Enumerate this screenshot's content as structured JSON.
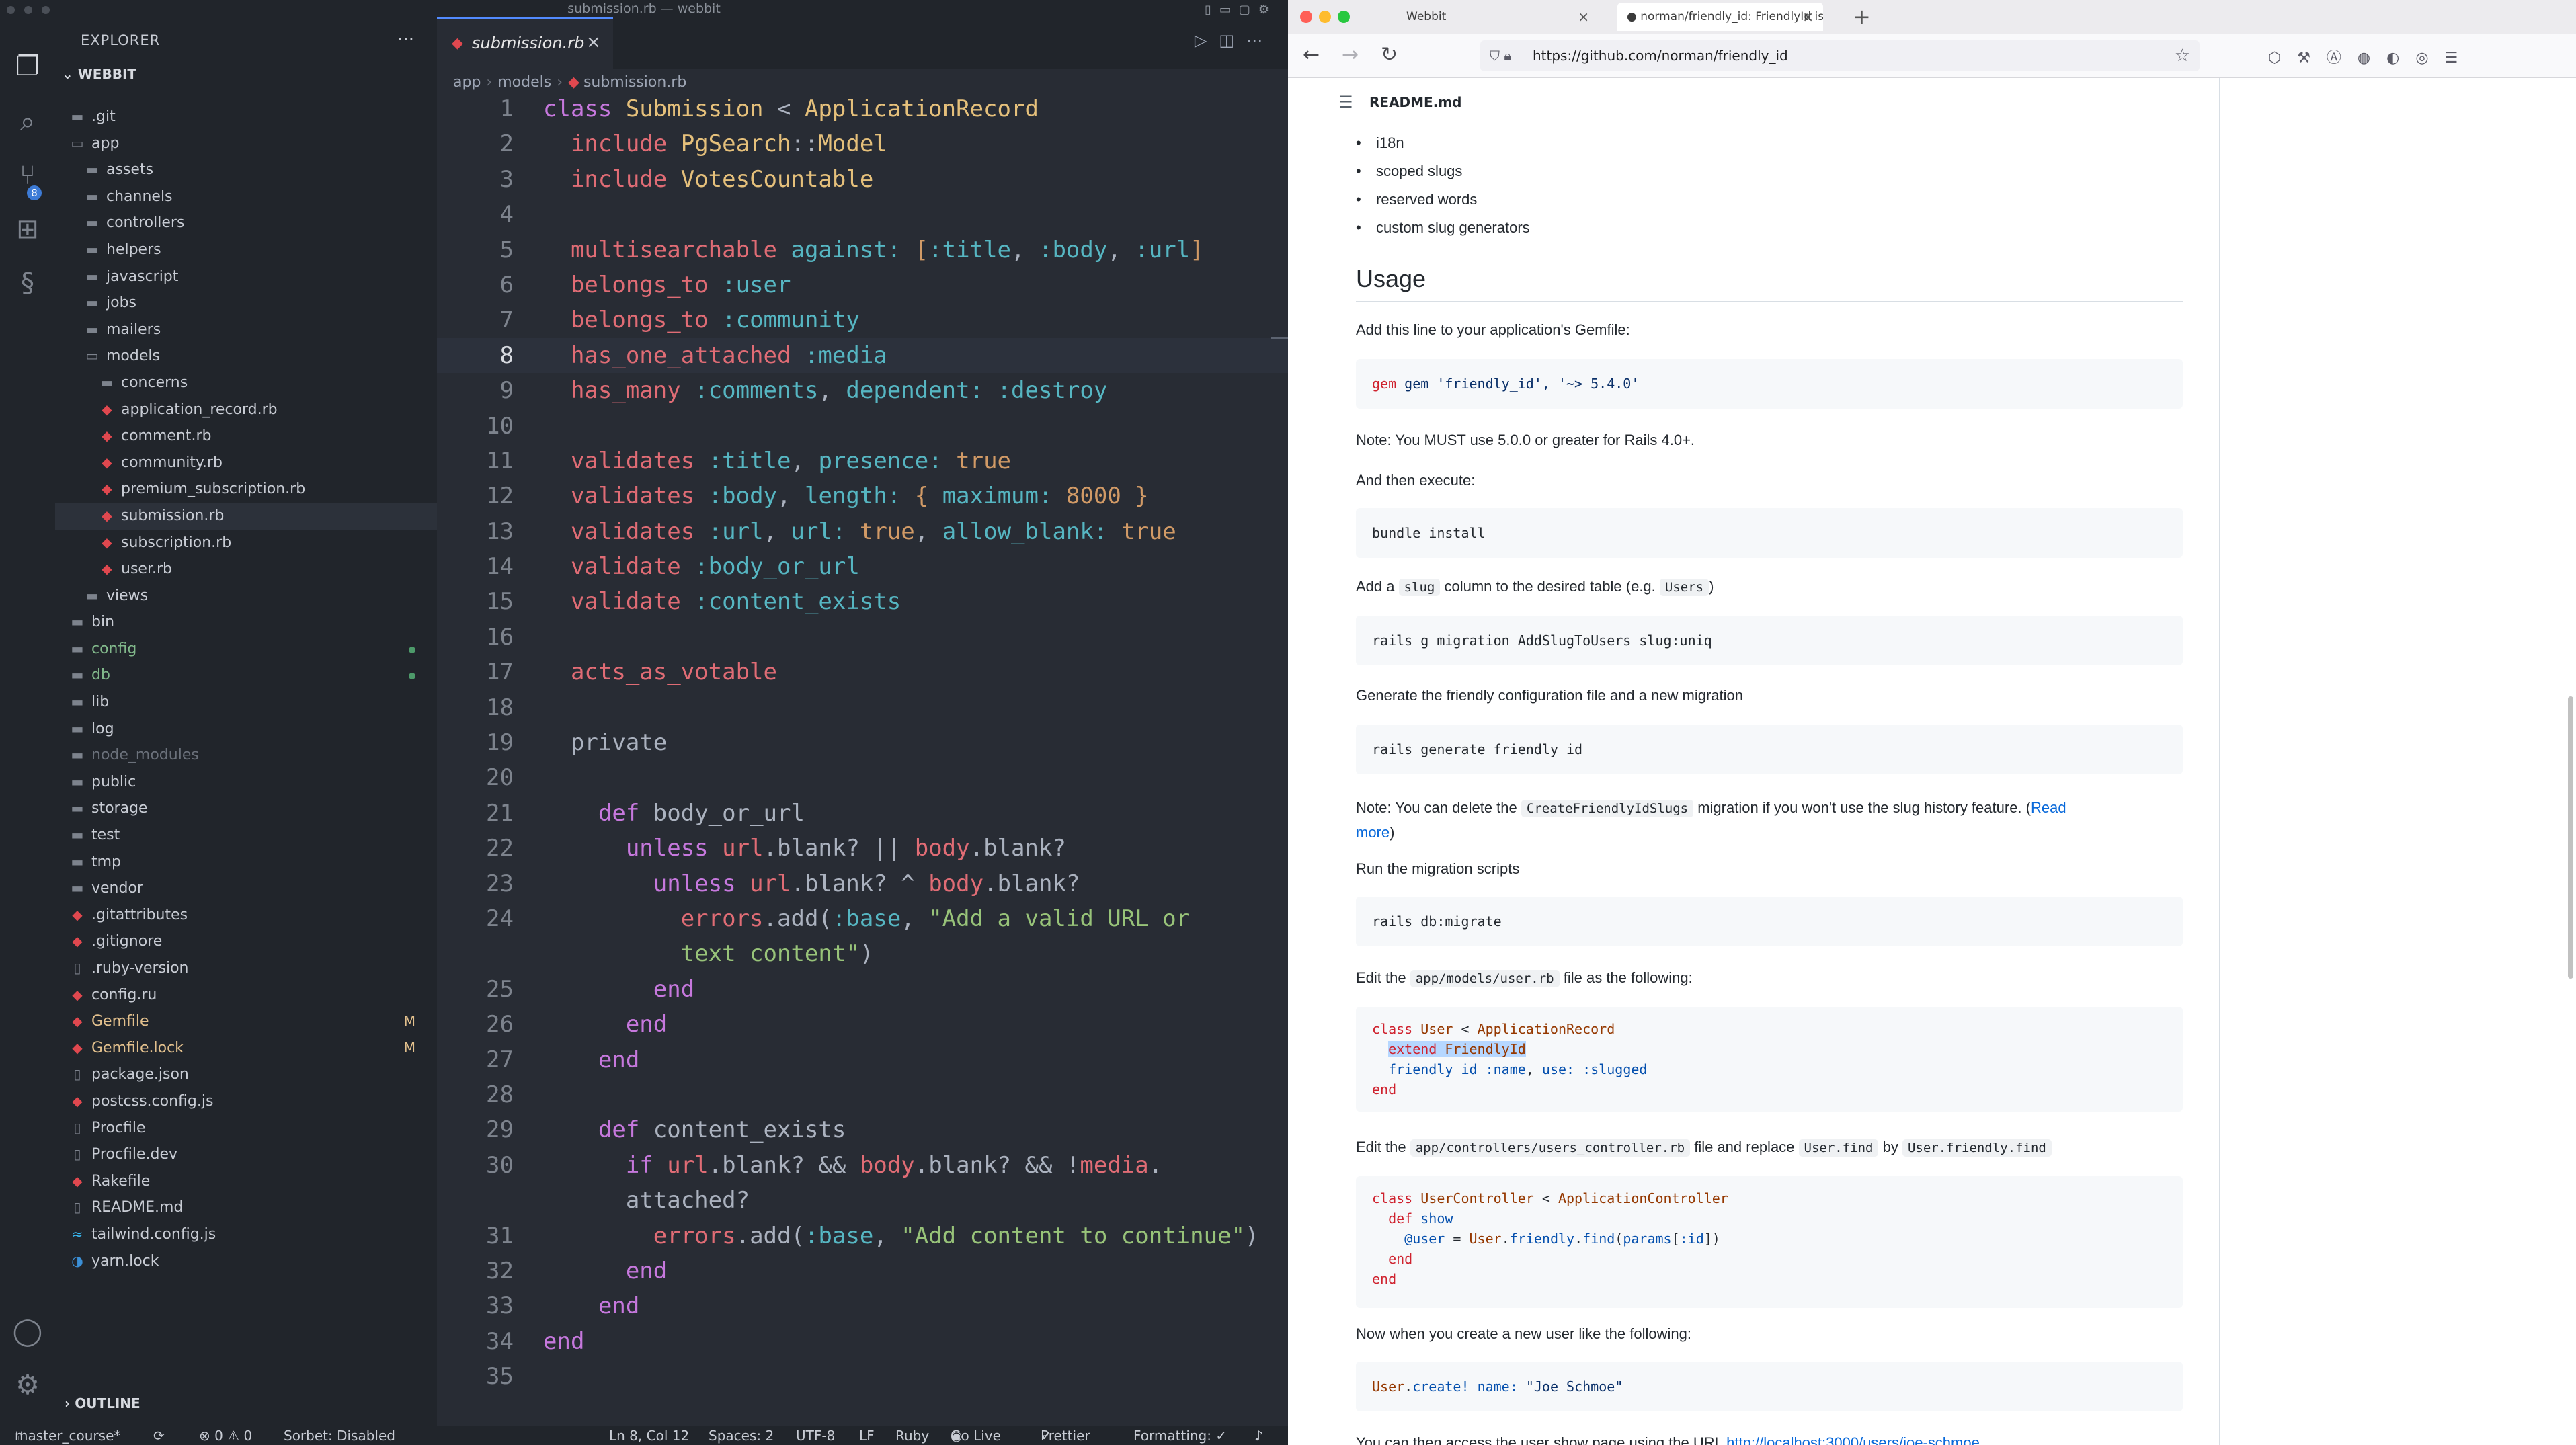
{
  "editor": {
    "window_title": "submission.rb — webbit",
    "activity_badge": "8",
    "explorer": {
      "header": "EXPLORER",
      "more": "···",
      "root": "WEBBIT",
      "tree": [
        {
          "label": ".git",
          "depth": 0,
          "kind": "folder",
          "chev": "›"
        },
        {
          "label": "app",
          "depth": 0,
          "kind": "folder-open",
          "chev": "⌄"
        },
        {
          "label": "assets",
          "depth": 1,
          "kind": "folder",
          "chev": "›"
        },
        {
          "label": "channels",
          "depth": 1,
          "kind": "folder",
          "chev": "›"
        },
        {
          "label": "controllers",
          "depth": 1,
          "kind": "folder",
          "chev": "›"
        },
        {
          "label": "helpers",
          "depth": 1,
          "kind": "folder",
          "chev": "›"
        },
        {
          "label": "javascript",
          "depth": 1,
          "kind": "folder",
          "chev": "›"
        },
        {
          "label": "jobs",
          "depth": 1,
          "kind": "folder",
          "chev": "›"
        },
        {
          "label": "mailers",
          "depth": 1,
          "kind": "folder",
          "chev": "›"
        },
        {
          "label": "models",
          "depth": 1,
          "kind": "folder-open",
          "chev": "⌄"
        },
        {
          "label": "concerns",
          "depth": 2,
          "kind": "folder",
          "chev": "›"
        },
        {
          "label": "application_record.rb",
          "depth": 2,
          "kind": "ruby"
        },
        {
          "label": "comment.rb",
          "depth": 2,
          "kind": "ruby"
        },
        {
          "label": "community.rb",
          "depth": 2,
          "kind": "ruby"
        },
        {
          "label": "premium_subscription.rb",
          "depth": 2,
          "kind": "ruby"
        },
        {
          "label": "submission.rb",
          "depth": 2,
          "kind": "ruby",
          "selected": true
        },
        {
          "label": "subscription.rb",
          "depth": 2,
          "kind": "ruby"
        },
        {
          "label": "user.rb",
          "depth": 2,
          "kind": "ruby"
        },
        {
          "label": "views",
          "depth": 1,
          "kind": "folder",
          "chev": "›"
        },
        {
          "label": "bin",
          "depth": 0,
          "kind": "folder",
          "chev": "›"
        },
        {
          "label": "config",
          "depth": 0,
          "kind": "folder",
          "chev": "›",
          "git": true,
          "dot": true
        },
        {
          "label": "db",
          "depth": 0,
          "kind": "folder",
          "chev": "›",
          "git": true,
          "dot": true
        },
        {
          "label": "lib",
          "depth": 0,
          "kind": "folder",
          "chev": "›"
        },
        {
          "label": "log",
          "depth": 0,
          "kind": "folder",
          "chev": "›"
        },
        {
          "label": "node_modules",
          "depth": 0,
          "kind": "folder",
          "chev": "›",
          "dim": true
        },
        {
          "label": "public",
          "depth": 0,
          "kind": "folder",
          "chev": "›"
        },
        {
          "label": "storage",
          "depth": 0,
          "kind": "folder",
          "chev": "›"
        },
        {
          "label": "test",
          "depth": 0,
          "kind": "folder",
          "chev": "›"
        },
        {
          "label": "tmp",
          "depth": 0,
          "kind": "folder",
          "chev": "›"
        },
        {
          "label": "vendor",
          "depth": 0,
          "kind": "folder",
          "chev": "›"
        },
        {
          "label": ".gitattributes",
          "depth": 0,
          "kind": "gitfile"
        },
        {
          "label": ".gitignore",
          "depth": 0,
          "kind": "gitfile"
        },
        {
          "label": ".ruby-version",
          "depth": 0,
          "kind": "file"
        },
        {
          "label": "config.ru",
          "depth": 0,
          "kind": "ruby"
        },
        {
          "label": "Gemfile",
          "depth": 0,
          "kind": "ruby",
          "badge": "M",
          "mod": true
        },
        {
          "label": "Gemfile.lock",
          "depth": 0,
          "kind": "ruby",
          "badge": "M",
          "mod": true
        },
        {
          "label": "package.json",
          "depth": 0,
          "kind": "file"
        },
        {
          "label": "postcss.config.js",
          "depth": 0,
          "kind": "ruby"
        },
        {
          "label": "Procfile",
          "depth": 0,
          "kind": "file"
        },
        {
          "label": "Procfile.dev",
          "depth": 0,
          "kind": "file"
        },
        {
          "label": "Rakefile",
          "depth": 0,
          "kind": "ruby"
        },
        {
          "label": "README.md",
          "depth": 0,
          "kind": "file"
        },
        {
          "label": "tailwind.config.js",
          "depth": 0,
          "kind": "tw"
        },
        {
          "label": "yarn.lock",
          "depth": 0,
          "kind": "yarn"
        }
      ],
      "outline_label": "OUTLINE"
    },
    "tab": {
      "label": "submission.rb",
      "close": "×"
    },
    "breadcrumb": [
      "app",
      "models",
      "submission.rb"
    ],
    "current_line": 8,
    "code_lines": [
      {
        "n": "1",
        "t": [
          [
            "kw",
            "class "
          ],
          [
            "cls",
            "Submission"
          ],
          [
            "pl",
            " < "
          ],
          [
            "cls",
            "ApplicationRecord"
          ]
        ]
      },
      {
        "n": "2",
        "t": [
          [
            "pl",
            "  "
          ],
          [
            "fn",
            "include "
          ],
          [
            "cls",
            "PgSearch"
          ],
          [
            "pl",
            "::"
          ],
          [
            "cls",
            "Model"
          ]
        ]
      },
      {
        "n": "3",
        "t": [
          [
            "pl",
            "  "
          ],
          [
            "fn",
            "include "
          ],
          [
            "cls",
            "VotesCountable"
          ]
        ]
      },
      {
        "n": "4",
        "t": []
      },
      {
        "n": "5",
        "t": [
          [
            "pl",
            "  "
          ],
          [
            "fn",
            "multisearchable "
          ],
          [
            "sym",
            "against: "
          ],
          [
            "br",
            "["
          ],
          [
            "sym",
            ":title"
          ],
          [
            "pl",
            ", "
          ],
          [
            "sym",
            ":body"
          ],
          [
            "pl",
            ", "
          ],
          [
            "sym",
            ":url"
          ],
          [
            "br",
            "]"
          ]
        ]
      },
      {
        "n": "6",
        "t": [
          [
            "pl",
            "  "
          ],
          [
            "fn",
            "belongs_to "
          ],
          [
            "sym",
            ":user"
          ]
        ]
      },
      {
        "n": "7",
        "t": [
          [
            "pl",
            "  "
          ],
          [
            "fn",
            "belongs_to "
          ],
          [
            "sym",
            ":community"
          ]
        ]
      },
      {
        "n": "8",
        "t": [
          [
            "pl",
            "  "
          ],
          [
            "fn",
            "has_one_attached "
          ],
          [
            "sym",
            ":media"
          ]
        ]
      },
      {
        "n": "9",
        "t": [
          [
            "pl",
            "  "
          ],
          [
            "fn",
            "has_many "
          ],
          [
            "sym",
            ":comments"
          ],
          [
            "pl",
            ", "
          ],
          [
            "sym",
            "dependent: :destroy"
          ]
        ]
      },
      {
        "n": "10",
        "t": []
      },
      {
        "n": "11",
        "t": [
          [
            "pl",
            "  "
          ],
          [
            "fn",
            "validates "
          ],
          [
            "sym",
            ":title"
          ],
          [
            "pl",
            ", "
          ],
          [
            "sym",
            "presence: "
          ],
          [
            "br",
            "true"
          ]
        ]
      },
      {
        "n": "12",
        "t": [
          [
            "pl",
            "  "
          ],
          [
            "fn",
            "validates "
          ],
          [
            "sym",
            ":body"
          ],
          [
            "pl",
            ", "
          ],
          [
            "sym",
            "length: "
          ],
          [
            "br",
            "{ "
          ],
          [
            "sym",
            "maximum: "
          ],
          [
            "br",
            "8000 }"
          ]
        ]
      },
      {
        "n": "13",
        "t": [
          [
            "pl",
            "  "
          ],
          [
            "fn",
            "validates "
          ],
          [
            "sym",
            ":url"
          ],
          [
            "pl",
            ", "
          ],
          [
            "sym",
            "url: "
          ],
          [
            "br",
            "true"
          ],
          [
            "pl",
            ", "
          ],
          [
            "sym",
            "allow_blank: "
          ],
          [
            "br",
            "true"
          ]
        ]
      },
      {
        "n": "14",
        "t": [
          [
            "pl",
            "  "
          ],
          [
            "fn",
            "validate "
          ],
          [
            "sym",
            ":body_or_url"
          ]
        ]
      },
      {
        "n": "15",
        "t": [
          [
            "pl",
            "  "
          ],
          [
            "fn",
            "validate "
          ],
          [
            "sym",
            ":content_exists"
          ]
        ]
      },
      {
        "n": "16",
        "t": []
      },
      {
        "n": "17",
        "t": [
          [
            "pl",
            "  "
          ],
          [
            "fn",
            "acts_as_votable"
          ]
        ]
      },
      {
        "n": "18",
        "t": []
      },
      {
        "n": "19",
        "t": [
          [
            "pl",
            "  "
          ],
          [
            "pl",
            "private"
          ]
        ]
      },
      {
        "n": "20",
        "t": []
      },
      {
        "n": "21",
        "t": [
          [
            "pl",
            "    "
          ],
          [
            "kw",
            "def "
          ],
          [
            "pl",
            "body_or_url"
          ]
        ]
      },
      {
        "n": "22",
        "t": [
          [
            "pl",
            "      "
          ],
          [
            "kw",
            "unless "
          ],
          [
            "fn",
            "url"
          ],
          [
            "pl",
            ".blank? || "
          ],
          [
            "fn",
            "body"
          ],
          [
            "pl",
            ".blank?"
          ]
        ]
      },
      {
        "n": "23",
        "t": [
          [
            "pl",
            "        "
          ],
          [
            "kw",
            "unless "
          ],
          [
            "fn",
            "url"
          ],
          [
            "pl",
            ".blank? ^ "
          ],
          [
            "fn",
            "body"
          ],
          [
            "pl",
            ".blank?"
          ]
        ]
      },
      {
        "n": "24",
        "t": [
          [
            "pl",
            "          "
          ],
          [
            "fn",
            "errors"
          ],
          [
            "pl",
            ".add("
          ],
          [
            "sym",
            ":base"
          ],
          [
            "pl",
            ", "
          ],
          [
            "str",
            "\"Add a valid URL or"
          ]
        ]
      },
      {
        "n": "",
        "t": [
          [
            "pl",
            "          "
          ],
          [
            "str",
            "text content\""
          ],
          [
            "pl",
            ")"
          ]
        ]
      },
      {
        "n": "25",
        "t": [
          [
            "pl",
            "        "
          ],
          [
            "kw",
            "end"
          ]
        ]
      },
      {
        "n": "26",
        "t": [
          [
            "pl",
            "      "
          ],
          [
            "kw",
            "end"
          ]
        ]
      },
      {
        "n": "27",
        "t": [
          [
            "pl",
            "    "
          ],
          [
            "kw",
            "end"
          ]
        ]
      },
      {
        "n": "28",
        "t": []
      },
      {
        "n": "29",
        "t": [
          [
            "pl",
            "    "
          ],
          [
            "kw",
            "def "
          ],
          [
            "pl",
            "content_exists"
          ]
        ]
      },
      {
        "n": "30",
        "t": [
          [
            "pl",
            "      "
          ],
          [
            "kw",
            "if "
          ],
          [
            "fn",
            "url"
          ],
          [
            "pl",
            ".blank? && "
          ],
          [
            "fn",
            "body"
          ],
          [
            "pl",
            ".blank? && !"
          ],
          [
            "fn",
            "media"
          ],
          [
            "pl",
            "."
          ]
        ]
      },
      {
        "n": "",
        "t": [
          [
            "pl",
            "      attached?"
          ]
        ]
      },
      {
        "n": "31",
        "t": [
          [
            "pl",
            "        "
          ],
          [
            "fn",
            "errors"
          ],
          [
            "pl",
            ".add("
          ],
          [
            "sym",
            ":base"
          ],
          [
            "pl",
            ", "
          ],
          [
            "str",
            "\"Add content to continue\""
          ],
          [
            "pl",
            ")"
          ]
        ]
      },
      {
        "n": "32",
        "t": [
          [
            "pl",
            "      "
          ],
          [
            "kw",
            "end"
          ]
        ]
      },
      {
        "n": "33",
        "t": [
          [
            "pl",
            "    "
          ],
          [
            "kw",
            "end"
          ]
        ]
      },
      {
        "n": "34",
        "t": [
          [
            "kw",
            "end"
          ]
        ]
      },
      {
        "n": "35",
        "t": []
      }
    ],
    "status": {
      "branch": "master_course*",
      "problems": "⊗ 0 ⚠ 0",
      "sorbet": "Sorbet: Disabled",
      "position": "Ln 8, Col 12",
      "spaces": "Spaces: 2",
      "encoding": "UTF-8",
      "eol": "LF",
      "language": "Ruby",
      "golive": "Go Live",
      "prettier": "Prettier",
      "formatting": "Formatting: ✓"
    }
  },
  "browser": {
    "tabs": [
      {
        "label": "Webbit",
        "active": false
      },
      {
        "label": "norman/friendly_id: FriendlyId is",
        "active": true
      }
    ],
    "url": "https://github.com/norman/friendly_id",
    "readme_file": "README.md",
    "bullets": [
      "i18n",
      "scoped slugs",
      "reserved words",
      "custom slug generators"
    ],
    "h2_usage": "Usage",
    "p_add_line": "Add this line to your application's Gemfile:",
    "code_gemfile": "gem 'friendly_id', '~> 5.4.0'",
    "p_note_version": "Note: You MUST use 5.0.0 or greater for Rails 4.0+.",
    "p_execute": "And then execute:",
    "code_bundle": "bundle install",
    "p_add_slug_a": "Add a ",
    "p_add_slug_code": "slug",
    "p_add_slug_b": " column to the desired table (e.g. ",
    "p_add_slug_code2": "Users",
    "p_add_slug_c": ")",
    "code_migration": "rails g migration AddSlugToUsers slug:uniq",
    "p_generate": "Generate the friendly configuration file and a new migration",
    "code_generate": "rails generate friendly_id",
    "p_note_delete_a": "Note: You can delete the ",
    "p_note_delete_code": "CreateFriendlyIdSlugs",
    "p_note_delete_b": " migration if you won't use the slug history feature. (",
    "p_note_delete_link": "Read",
    "p_note_delete_link2": "more",
    "p_note_delete_c": ")",
    "p_run": "Run the migration scripts",
    "code_migrate": "rails db:migrate",
    "p_edit_user_a": "Edit the ",
    "p_edit_user_code": "app/models/user.rb",
    "p_edit_user_b": " file as the following:",
    "p_edit_ctrl_a": "Edit the ",
    "p_edit_ctrl_code": "app/controllers/users_controller.rb",
    "p_edit_ctrl_b": " file and replace ",
    "p_edit_ctrl_code2": "User.find",
    "p_edit_ctrl_c": " by ",
    "p_edit_ctrl_code3": "User.friendly.find",
    "p_now": "Now when you create a new user like the following:",
    "p_access": "You can then access the user show page using the URL ",
    "p_access_link": "http://localhost:3000/users/joe-schmoe"
  }
}
